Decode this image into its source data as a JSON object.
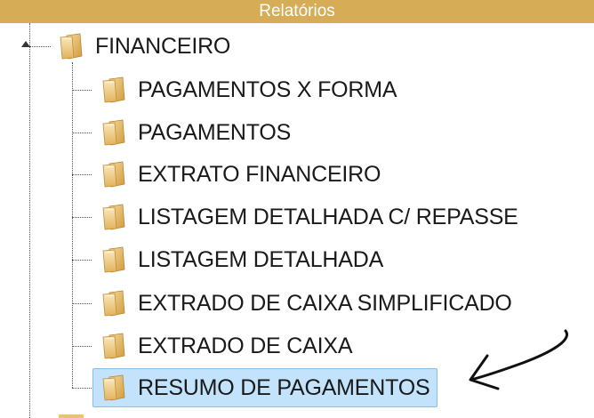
{
  "header": {
    "title": "Relatórios"
  },
  "tree": {
    "root": {
      "label": "FINANCEIRO",
      "icon": "folder-icon",
      "expanded": true
    },
    "children": [
      {
        "label": "PAGAMENTOS X FORMA"
      },
      {
        "label": "PAGAMENTOS"
      },
      {
        "label": "EXTRATO FINANCEIRO"
      },
      {
        "label": "LISTAGEM DETALHADA C/ REPASSE"
      },
      {
        "label": "LISTAGEM DETALHADA"
      },
      {
        "label": "EXTRADO DE CAIXA SIMPLIFICADO"
      },
      {
        "label": "EXTRADO DE CAIXA"
      },
      {
        "label": "RESUMO DE PAGAMENTOS",
        "selected": true
      }
    ]
  },
  "colors": {
    "header_bg": "#d6ac56",
    "header_text": "#ffffff",
    "selection_bg": "#c2e3fb",
    "selection_border": "#86c0e8"
  },
  "annotation": {
    "type": "hand-drawn-arrow",
    "points_to": "RESUMO DE PAGAMENTOS"
  }
}
